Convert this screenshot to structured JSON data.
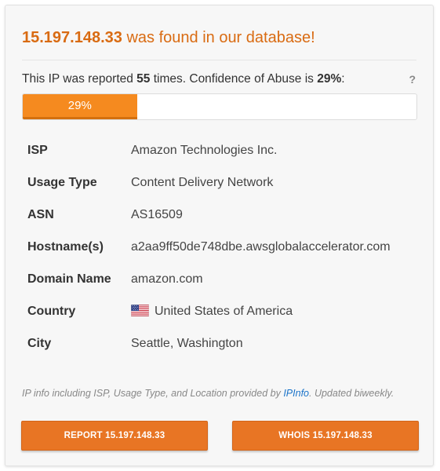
{
  "header": {
    "ip": "15.197.148.33",
    "found_text": " was found in our database!"
  },
  "report": {
    "prefix": "This IP was reported ",
    "count": "55",
    "mid": " times. Confidence of Abuse is ",
    "confidence": "29%",
    "suffix": ":",
    "help_label": "?"
  },
  "confidence_bar": {
    "percent": 29,
    "label": "29%",
    "fill_color": "#f58a1f"
  },
  "details": [
    {
      "key": "ISP",
      "value": "Amazon Technologies Inc."
    },
    {
      "key": "Usage Type",
      "value": "Content Delivery Network"
    },
    {
      "key": "ASN",
      "value": "AS16509"
    },
    {
      "key": "Hostname(s)",
      "value": "a2aa9ff50de748dbe.awsglobalaccelerator.com"
    },
    {
      "key": "Domain Name",
      "value": "amazon.com"
    },
    {
      "key": "Country",
      "value": "United States of America",
      "icon": "us-flag-icon"
    },
    {
      "key": "City",
      "value": "Seattle, Washington"
    }
  ],
  "note": {
    "prefix": "IP info including ISP, Usage Type, and Location provided by ",
    "link": "IPInfo",
    "suffix": ". Updated biweekly."
  },
  "buttons": {
    "report": "REPORT 15.197.148.33",
    "whois": "WHOIS 15.197.148.33"
  },
  "colors": {
    "accent": "#e87524",
    "title": "#d96b12",
    "link": "#1a73c9"
  }
}
